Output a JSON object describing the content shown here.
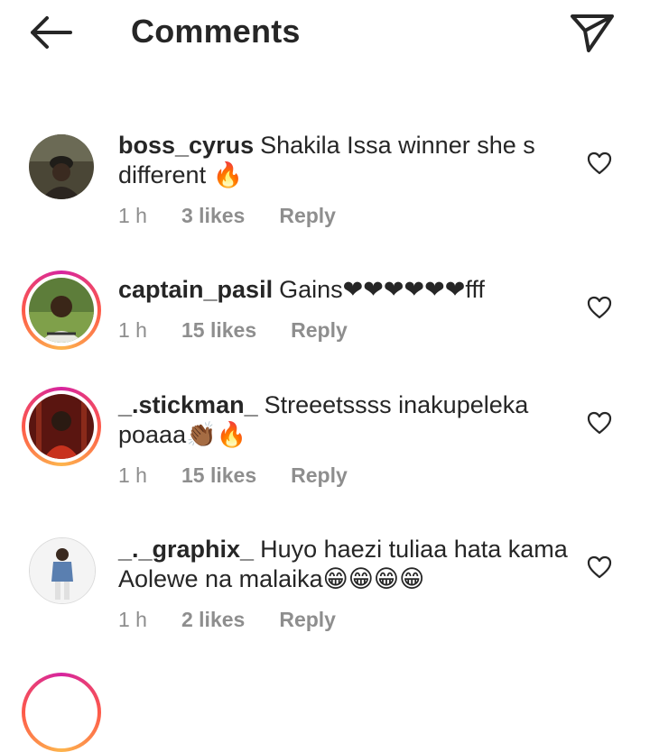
{
  "header": {
    "title": "Comments"
  },
  "comments": [
    {
      "username": "boss_cyrus",
      "text": "Shakila Issa winner she s different 🔥",
      "time": "1 h",
      "likes": "3 likes",
      "reply": "Reply"
    },
    {
      "username": "captain_pasil",
      "text": "Gains❤❤❤❤❤❤fff",
      "time": "1 h",
      "likes": "15 likes",
      "reply": "Reply"
    },
    {
      "username": "_.stickman_",
      "text": "Streeetssss inakupeleka poaaa👏🏾🔥",
      "time": "1 h",
      "likes": "15 likes",
      "reply": "Reply"
    },
    {
      "username": "_._graphix_",
      "text": "Huyo haezi tuliaa hata kama Aolewe na malaika😁😁😁😁",
      "time": "1 h",
      "likes": "2 likes",
      "reply": "Reply"
    }
  ],
  "icons": {
    "back": "back-arrow-icon",
    "send": "send-icon",
    "like": "heart-outline-icon"
  },
  "colors": {
    "text": "#262626",
    "meta": "#8e8e8e",
    "story_ring": "#d6249f"
  }
}
